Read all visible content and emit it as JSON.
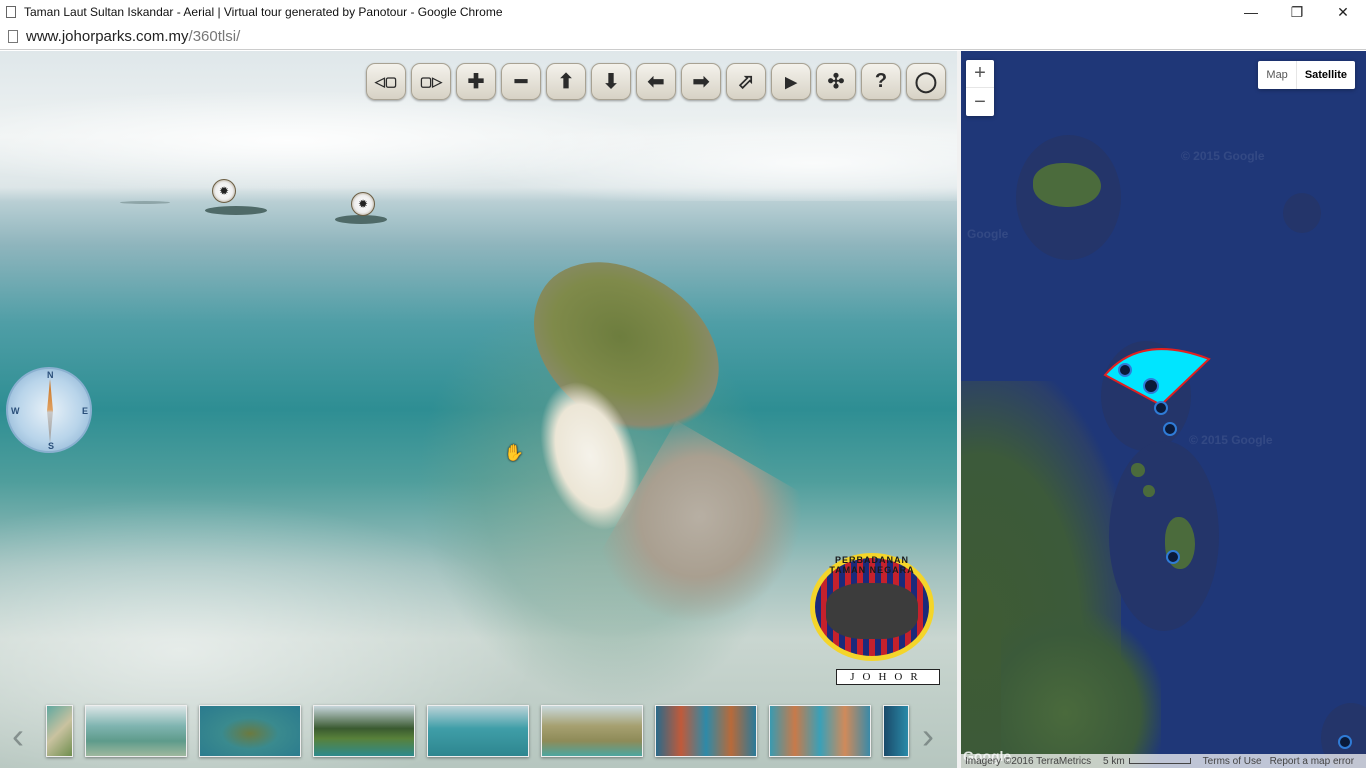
{
  "window": {
    "title": "Taman Laut Sultan Iskandar - Aerial | Virtual tour generated by Panotour - Google Chrome",
    "controls": {
      "minimize": "—",
      "restore": "❐",
      "close": "✕"
    }
  },
  "address": {
    "host": "www.johorparks.com.my",
    "path": "/360tlsi/"
  },
  "toolbar": {
    "buttons": [
      {
        "name": "prev-pano-button",
        "glyph": "◁▢"
      },
      {
        "name": "next-pano-button",
        "glyph": "▢▷"
      },
      {
        "name": "zoom-in-button",
        "glyph": "✚"
      },
      {
        "name": "zoom-out-button",
        "glyph": "━"
      },
      {
        "name": "move-up-button",
        "glyph": "⬆"
      },
      {
        "name": "move-down-button",
        "glyph": "⬇"
      },
      {
        "name": "move-left-button",
        "glyph": "⬅"
      },
      {
        "name": "move-right-button",
        "glyph": "➡"
      },
      {
        "name": "hide-controls-button",
        "glyph": "⬀"
      },
      {
        "name": "autorotate-button",
        "glyph": "▶"
      },
      {
        "name": "fullscreen-button",
        "glyph": "✣"
      },
      {
        "name": "help-button",
        "glyph": "?"
      },
      {
        "name": "projection-button",
        "glyph": "◯"
      }
    ]
  },
  "hotspots": {
    "glyph": "✹"
  },
  "compass": {
    "n": "N",
    "s": "S",
    "e": "E",
    "w": "W"
  },
  "logo": {
    "arc_text": "PERBADANAN TAMAN NEGARA",
    "plate": "JOHOR"
  },
  "thumbstrip": {
    "prev": "‹",
    "next": "›",
    "thumb_count": 9
  },
  "map": {
    "zoom_in": "+",
    "zoom_out": "−",
    "type_map": "Map",
    "type_satellite": "Satellite",
    "watermark": "© 2015 Google",
    "watermark_short": "Google",
    "footer": {
      "logo": "Google",
      "imagery": "Imagery ©2016 TerraMetrics",
      "scale": "5 km",
      "terms": "Terms of Use",
      "report": "Report a map error"
    }
  },
  "colors": {
    "fov_fill": "#00e5ff",
    "fov_stroke": "#e02020",
    "map_water": "#1f3778"
  }
}
